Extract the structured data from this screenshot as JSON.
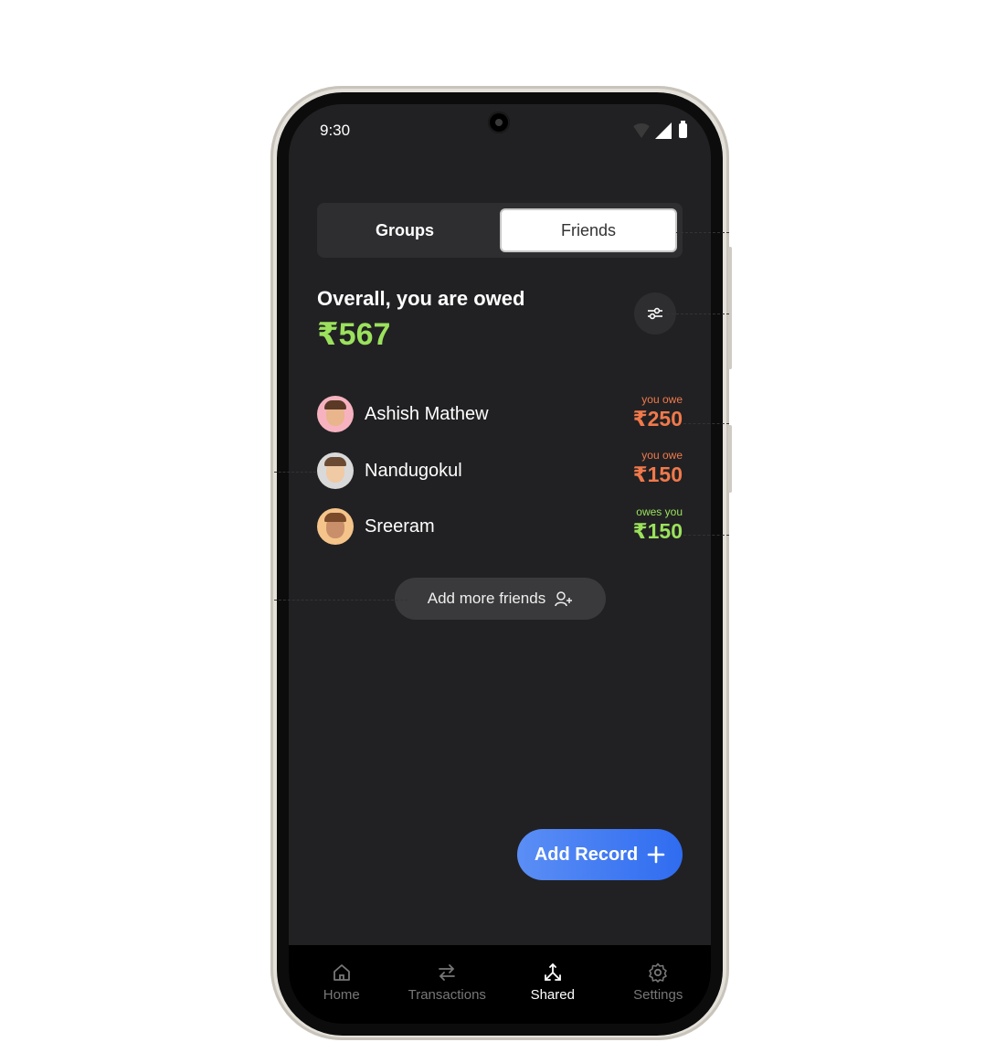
{
  "status": {
    "time": "9:30"
  },
  "toggle": {
    "groups": "Groups",
    "friends": "Friends"
  },
  "summary": {
    "title": "Overall, you are owed",
    "amount": "₹567"
  },
  "friends": [
    {
      "name": "Ashish Mathew",
      "label": "you owe",
      "amount": "₹250",
      "status": "owe"
    },
    {
      "name": "Nandugokul",
      "label": "you owe",
      "amount": "₹150",
      "status": "owe"
    },
    {
      "name": "Sreeram",
      "label": "owes you",
      "amount": "₹150",
      "status": "owed"
    }
  ],
  "add_friends": {
    "label": "Add more friends"
  },
  "add_record": {
    "label": "Add Record"
  },
  "nav": [
    {
      "label": "Home",
      "icon": "home-icon"
    },
    {
      "label": "Transactions",
      "icon": "transactions-icon"
    },
    {
      "label": "Shared",
      "icon": "shared-icon",
      "active": true
    },
    {
      "label": "Settings",
      "icon": "settings-icon"
    }
  ],
  "colors": {
    "background": "#212123",
    "positive": "#9be15d",
    "negative": "#f0794b",
    "accent": "#2f6cf0"
  }
}
